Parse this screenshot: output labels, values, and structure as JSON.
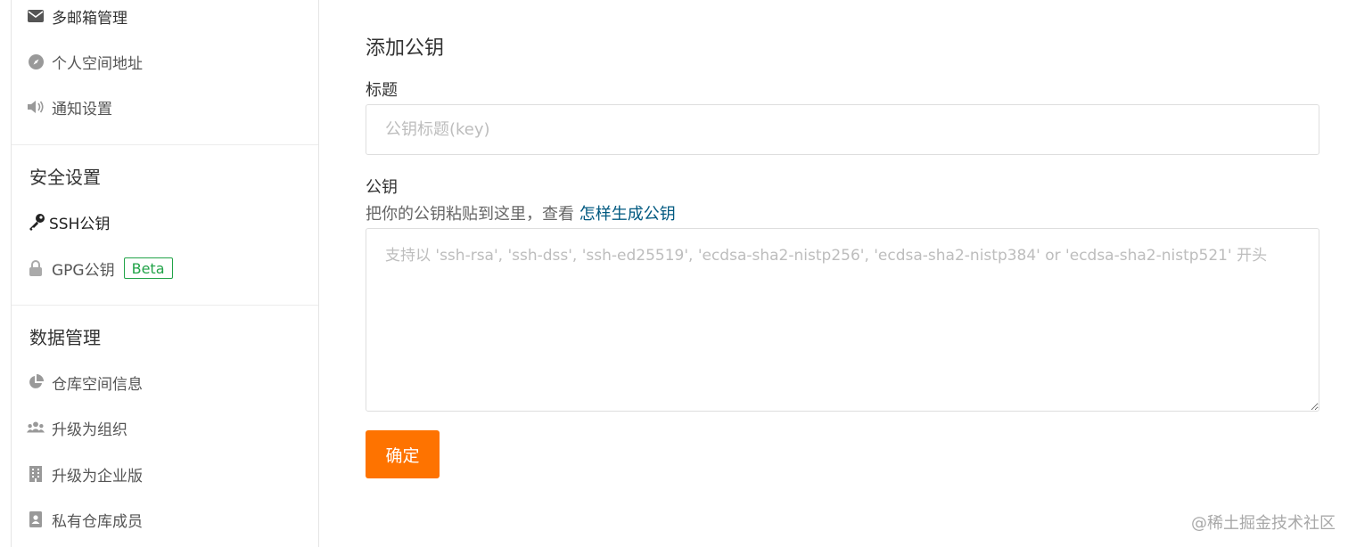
{
  "sidebar": {
    "items_top": [
      {
        "label": "多邮箱管理",
        "icon": "envelope-icon"
      },
      {
        "label": "个人空间地址",
        "icon": "compass-icon"
      },
      {
        "label": "通知设置",
        "icon": "volume-icon"
      }
    ],
    "security_heading": "安全设置",
    "security_items": [
      {
        "label": "SSH公钥",
        "icon": "key-icon",
        "active": true
      },
      {
        "label": "GPG公钥",
        "icon": "lock-icon",
        "badge": "Beta"
      }
    ],
    "data_heading": "数据管理",
    "data_items": [
      {
        "label": "仓库空间信息",
        "icon": "pie-chart-icon"
      },
      {
        "label": "升级为组织",
        "icon": "users-icon"
      },
      {
        "label": "升级为企业版",
        "icon": "building-icon"
      },
      {
        "label": "私有仓库成员",
        "icon": "contact-card-icon"
      }
    ]
  },
  "form": {
    "title": "添加公钥",
    "title_label": "标题",
    "title_placeholder": "公钥标题(key)",
    "key_label": "公钥",
    "key_hint": "把你的公钥粘贴到这里，查看",
    "key_hint_link": "怎样生成公钥",
    "key_placeholder": "支持以 'ssh-rsa', 'ssh-dss', 'ssh-ed25519', 'ecdsa-sha2-nistp256', 'ecdsa-sha2-nistp384' or 'ecdsa-sha2-nistp521' 开头",
    "submit_label": "确定"
  },
  "watermark": "@稀土掘金技术社区",
  "colors": {
    "accent": "#fe7300",
    "link": "#005980",
    "badge": "#21a348",
    "icon": "#999999"
  }
}
